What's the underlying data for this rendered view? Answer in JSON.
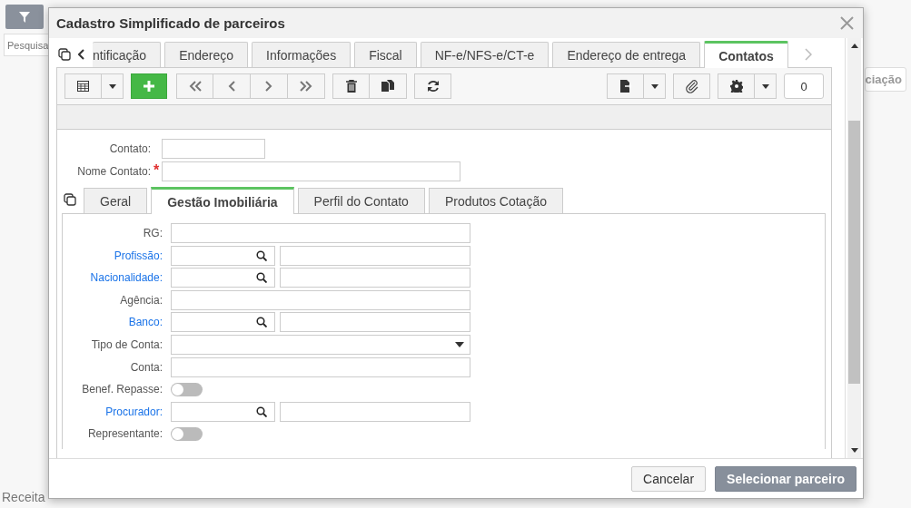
{
  "background": {
    "search": {
      "placeholder": "Pesquisa"
    },
    "button_text": "ciação",
    "footer_label": "Receita"
  },
  "dialog": {
    "title": "Cadastro Simplificado de parceiros",
    "tabs": [
      {
        "label": "ntificação",
        "selected": false
      },
      {
        "label": "Endereço",
        "selected": false
      },
      {
        "label": "Informações",
        "selected": false
      },
      {
        "label": "Fiscal",
        "selected": false
      },
      {
        "label": "NF-e/NFS-e/CT-e",
        "selected": false
      },
      {
        "label": "Endereço de entrega",
        "selected": false
      },
      {
        "label": "Contatos",
        "selected": true
      }
    ],
    "counter": "0",
    "fields": [
      {
        "label": "Contato:"
      },
      {
        "label": "Nome Contato:",
        "required_mark": "*"
      }
    ],
    "subtabs": [
      {
        "label": "Geral",
        "selected": false
      },
      {
        "label": "Gestão Imobiliária",
        "selected": true
      },
      {
        "label": "Perfil do Contato",
        "selected": false
      },
      {
        "label": "Produtos Cotação",
        "selected": false
      }
    ],
    "form": [
      {
        "kind": "text",
        "label": "RG:",
        "link": false
      },
      {
        "kind": "lookup",
        "label": "Profissão:",
        "link": true
      },
      {
        "kind": "lookup",
        "label": "Nacionalidade:",
        "link": true
      },
      {
        "kind": "text",
        "label": "Agência:",
        "link": false
      },
      {
        "kind": "lookup",
        "label": "Banco:",
        "link": true
      },
      {
        "kind": "select",
        "label": "Tipo de Conta:",
        "link": false
      },
      {
        "kind": "text",
        "label": "Conta:",
        "link": false
      },
      {
        "kind": "toggle",
        "label": "Benef. Repasse:",
        "link": false,
        "on": false
      },
      {
        "kind": "lookup",
        "label": "Procurador:",
        "link": true
      },
      {
        "kind": "toggle",
        "label": "Representante:",
        "link": false,
        "on": false
      }
    ],
    "buttons": [
      {
        "label": "Cancelar",
        "kind": "secondary"
      },
      {
        "label": "Selecionar parceiro",
        "kind": "primary"
      }
    ]
  }
}
